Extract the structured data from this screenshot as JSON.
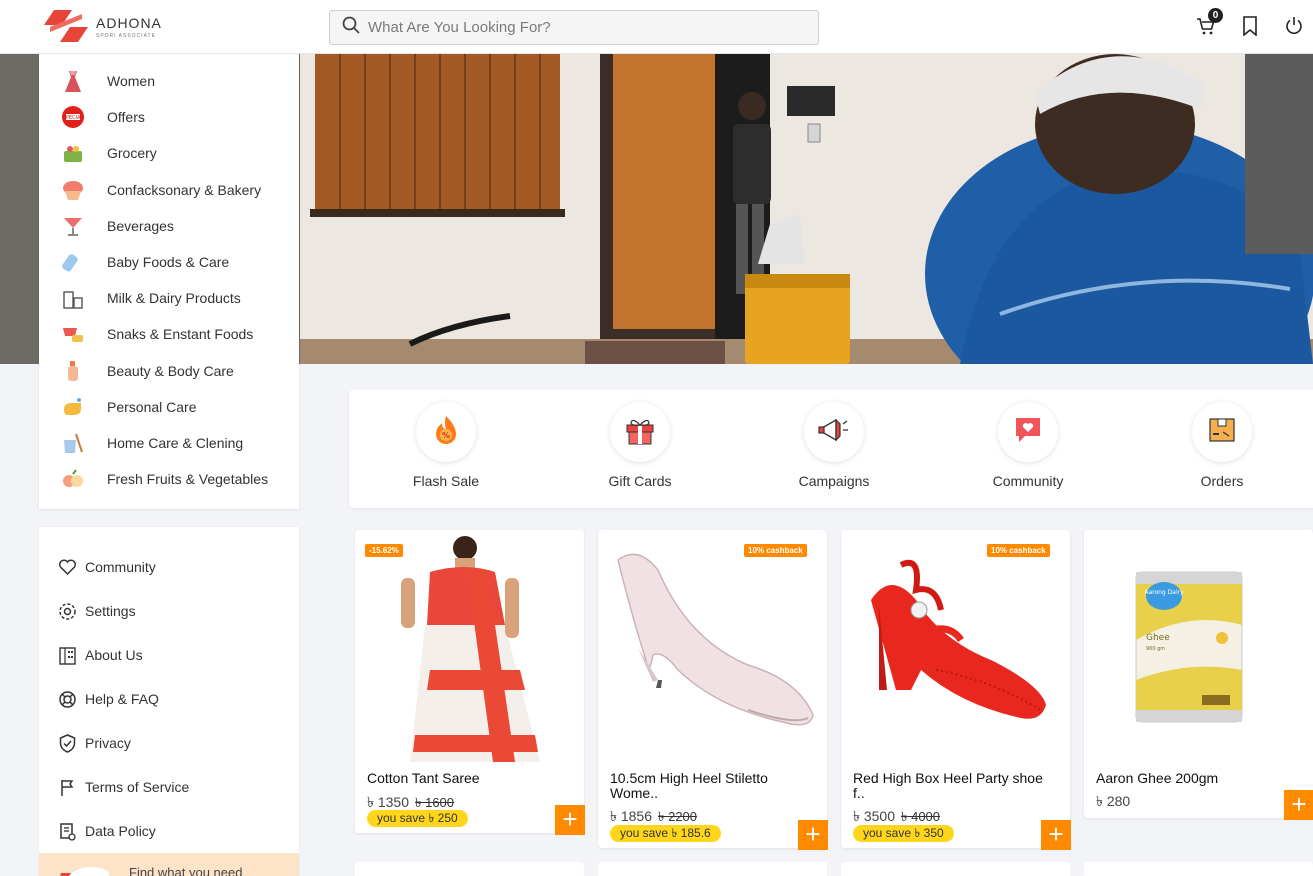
{
  "header": {
    "brand_name": "ADHONA",
    "brand_sub": "SPORI ASSOCIATE",
    "search_placeholder": "What Are You Looking For?",
    "cart_count": "0"
  },
  "categories": [
    {
      "label": "Women",
      "icon": "dress-icon"
    },
    {
      "label": "Offers",
      "icon": "offer-tag-icon"
    },
    {
      "label": "Grocery",
      "icon": "grocery-basket-icon"
    },
    {
      "label": "Confacksonary & Bakery",
      "icon": "cupcake-icon"
    },
    {
      "label": "Beverages",
      "icon": "cocktail-icon"
    },
    {
      "label": "Baby Foods & Care",
      "icon": "baby-bottle-icon"
    },
    {
      "label": "Milk & Dairy Products",
      "icon": "milk-icon"
    },
    {
      "label": "Snaks & Enstant Foods",
      "icon": "snacks-icon"
    },
    {
      "label": "Beauty & Body Care",
      "icon": "lotion-icon"
    },
    {
      "label": "Personal Care",
      "icon": "hand-wash-icon"
    },
    {
      "label": "Home Care & Clening",
      "icon": "cleaning-icon"
    },
    {
      "label": "Fresh Fruits & Vegetables",
      "icon": "fruits-icon"
    }
  ],
  "quick_links": [
    {
      "label": "Flash Sale",
      "icon": "flash-sale-icon"
    },
    {
      "label": "Gift Cards",
      "icon": "gift-icon"
    },
    {
      "label": "Campaigns",
      "icon": "megaphone-icon"
    },
    {
      "label": "Community",
      "icon": "chat-heart-icon"
    },
    {
      "label": "Orders",
      "icon": "package-icon"
    }
  ],
  "side_menu": [
    {
      "label": "Community",
      "icon": "heart-icon"
    },
    {
      "label": "Settings",
      "icon": "gear-icon"
    },
    {
      "label": "About Us",
      "icon": "building-icon"
    },
    {
      "label": "Help & FAQ",
      "icon": "lifebuoy-icon"
    },
    {
      "label": "Privacy",
      "icon": "shield-icon"
    },
    {
      "label": "Terms of Service",
      "icon": "flag-icon"
    },
    {
      "label": "Data Policy",
      "icon": "document-icon"
    }
  ],
  "promo": {
    "text": "Find what you need"
  },
  "products": [
    {
      "title": "Cotton Tant Saree",
      "price": "৳ 1350",
      "old_price": "৳ 1600",
      "badge": "-15.62%",
      "save": "you save ৳ 250"
    },
    {
      "title": "10.5cm High Heel Stiletto Wome..",
      "price": "৳ 1856",
      "old_price": "৳ 2200",
      "badge": "10% cashback",
      "save": "you save ৳ 185.6"
    },
    {
      "title": "Red High Box Heel Party shoe f..",
      "price": "৳ 3500",
      "old_price": "৳ 4000",
      "badge": "10% cashback",
      "save": "you save ৳ 350"
    },
    {
      "title": "Aaron Ghee 200gm",
      "price": "৳ 280"
    }
  ],
  "ghee_label": {
    "brand": "Aarong Dairy",
    "product": "Ghee",
    "weight": "900 gm"
  },
  "colors": {
    "accent": "#ff8a00",
    "save_pill": "#ffd61c",
    "logo_red": "#e8443a"
  }
}
